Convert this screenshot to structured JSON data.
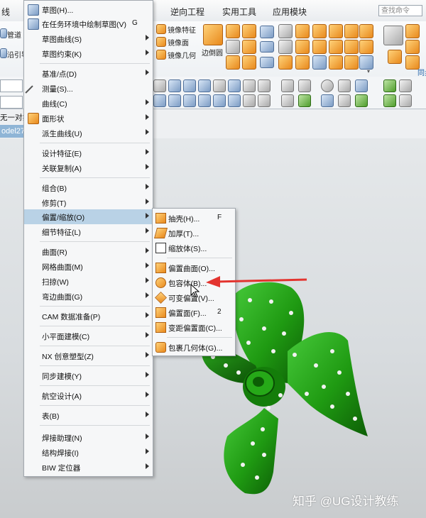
{
  "menubar": {
    "items": [
      "线",
      "逆向工程",
      "实用工具",
      "应用模块"
    ],
    "search_placeholder": "查找命令"
  },
  "ribbon": {
    "left_labels": [
      "管道",
      "沿引导"
    ],
    "mirror_labels": [
      "镜像特征",
      "镜像面",
      "镜像几何"
    ],
    "edge_label": "边倒圆",
    "right_label": "同步"
  },
  "left_panel": {
    "select_label": "无一对象",
    "model_tab": "odel27."
  },
  "main_menu": {
    "items": [
      {
        "label": "草图(H)...",
        "shortcut": "",
        "submenu": false,
        "icon": "sketch-icon"
      },
      {
        "label": "在任务环境中绘制草图(V)",
        "shortcut": "G",
        "submenu": false,
        "icon": "sketch-task-icon"
      },
      {
        "label": "草图曲线(S)",
        "shortcut": "",
        "submenu": true
      },
      {
        "label": "草图约束(K)",
        "shortcut": "",
        "submenu": true
      },
      {
        "label": "基准/点(D)",
        "shortcut": "",
        "submenu": true
      },
      {
        "label": "测量(S)...",
        "shortcut": "",
        "submenu": false,
        "icon": "ruler-icon"
      },
      {
        "label": "曲线(C)",
        "shortcut": "",
        "submenu": true
      },
      {
        "label": "面形状",
        "shortcut": "",
        "submenu": true,
        "icon": "face-shape-icon"
      },
      {
        "label": "派生曲线(U)",
        "shortcut": "",
        "submenu": true
      },
      {
        "label": "设计特征(E)",
        "shortcut": "",
        "submenu": true
      },
      {
        "label": "关联复制(A)",
        "shortcut": "",
        "submenu": true
      },
      {
        "label": "组合(B)",
        "shortcut": "",
        "submenu": true
      },
      {
        "label": "修剪(T)",
        "shortcut": "",
        "submenu": true
      },
      {
        "label": "偏置/缩放(O)",
        "shortcut": "",
        "submenu": true
      },
      {
        "label": "细节特征(L)",
        "shortcut": "",
        "submenu": true
      },
      {
        "label": "曲面(R)",
        "shortcut": "",
        "submenu": true
      },
      {
        "label": "网格曲面(M)",
        "shortcut": "",
        "submenu": true
      },
      {
        "label": "扫掠(W)",
        "shortcut": "",
        "submenu": true
      },
      {
        "label": "弯边曲面(G)",
        "shortcut": "",
        "submenu": true
      },
      {
        "label": "CAM 数据准备(P)",
        "shortcut": "",
        "submenu": true
      },
      {
        "label": "小平面建模(C)",
        "shortcut": "",
        "submenu": true
      },
      {
        "label": "NX 创意塑型(Z)",
        "shortcut": "",
        "submenu": true
      },
      {
        "label": "同步建模(Y)",
        "shortcut": "",
        "submenu": true
      },
      {
        "label": "航空设计(A)",
        "shortcut": "",
        "submenu": true
      },
      {
        "label": "表(B)",
        "shortcut": "",
        "submenu": true
      },
      {
        "label": "焊接助理(N)",
        "shortcut": "",
        "submenu": true
      },
      {
        "label": "结构焊接(I)",
        "shortcut": "",
        "submenu": true
      },
      {
        "label": "BIW 定位器",
        "shortcut": "",
        "submenu": true
      }
    ]
  },
  "sub_menu": {
    "items": [
      {
        "label": "抽壳(H)...",
        "shortcut": "F",
        "icon": "shell-icon"
      },
      {
        "label": "加厚(T)...",
        "shortcut": "",
        "icon": "thicken-icon"
      },
      {
        "label": "缩放体(S)...",
        "shortcut": "",
        "icon": "scale-body-icon"
      },
      {
        "label": "偏置曲面(O)...",
        "shortcut": "",
        "icon": "offset-surface-icon"
      },
      {
        "label": "包容体(B)...",
        "shortcut": "",
        "icon": "bounding-body-icon"
      },
      {
        "label": "可变偏置(V)...",
        "shortcut": "",
        "icon": "variable-offset-icon"
      },
      {
        "label": "偏置面(F)...",
        "shortcut": "2",
        "icon": "offset-face-icon"
      },
      {
        "label": "变距偏置面(C)...",
        "shortcut": "",
        "icon": "variable-distance-offset-icon"
      },
      {
        "label": "包裹几何体(G)...",
        "shortcut": "",
        "icon": "wrap-geometry-icon"
      }
    ]
  },
  "watermark": "知乎 @UG设计教练",
  "colors": {
    "menu_highlight": "#b9d2e6",
    "model_green": "#1f9a12",
    "annotation_arrow": "#e3342f",
    "highlight_circle": "#ffec00"
  }
}
